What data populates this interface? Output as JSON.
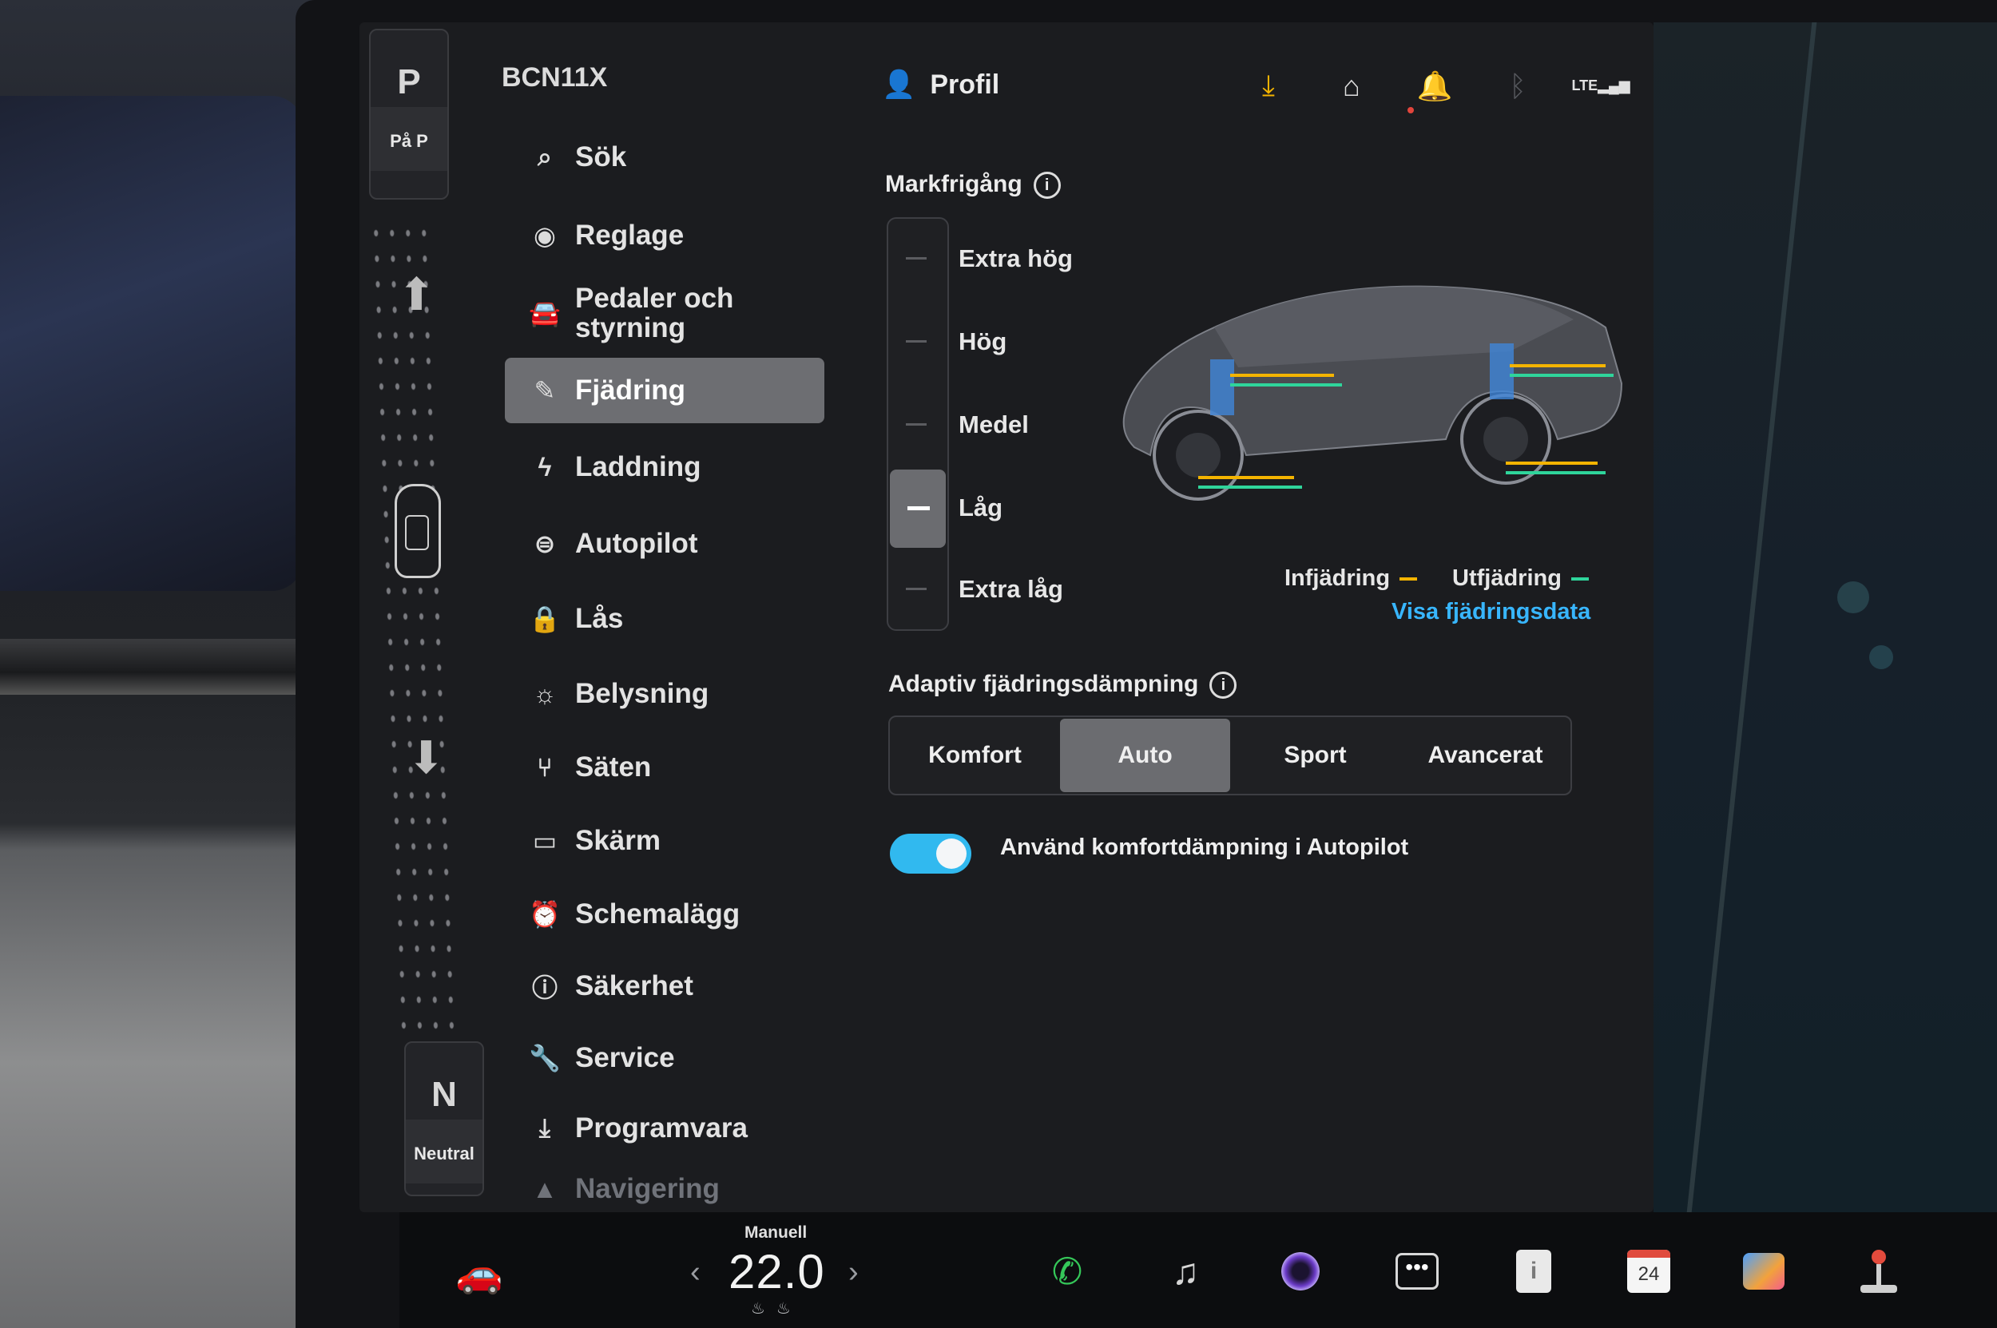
{
  "vehicle": {
    "name": "BCN11X"
  },
  "gear": {
    "top_letter": "P",
    "top_label": "På P",
    "bottom_letter": "N",
    "bottom_label": "Neutral"
  },
  "nav": {
    "items": [
      {
        "label": "Sök",
        "icon": "search-icon"
      },
      {
        "label": "Reglage",
        "icon": "toggle-icon"
      },
      {
        "label": "Pedaler och styrning",
        "icon": "car-icon"
      },
      {
        "label": "Fjädring",
        "icon": "suspension-icon",
        "active": true
      },
      {
        "label": "Laddning",
        "icon": "bolt-icon"
      },
      {
        "label": "Autopilot",
        "icon": "steering-wheel-icon"
      },
      {
        "label": "Lås",
        "icon": "lock-icon"
      },
      {
        "label": "Belysning",
        "icon": "sun-icon"
      },
      {
        "label": "Säten",
        "icon": "seat-icon"
      },
      {
        "label": "Skärm",
        "icon": "display-icon"
      },
      {
        "label": "Schemalägg",
        "icon": "alarm-clock-icon"
      },
      {
        "label": "Säkerhet",
        "icon": "alert-circle-icon"
      },
      {
        "label": "Service",
        "icon": "wrench-icon"
      },
      {
        "label": "Programvara",
        "icon": "download-icon"
      },
      {
        "label": "Navigering",
        "icon": "navigation-arrow-icon"
      }
    ]
  },
  "header": {
    "profile_label": "Profil",
    "status_icons": [
      "download-icon",
      "garage-icon",
      "bell-icon",
      "bluetooth-icon",
      "lte-signal-icon"
    ],
    "lte_label": "LTE",
    "accent_download": "#f4b400"
  },
  "ride_height": {
    "title": "Markfrigång",
    "levels": [
      "Extra hög",
      "Hög",
      "Medel",
      "Låg",
      "Extra låg"
    ],
    "selected": "Låg",
    "legend_compression": "Infjädring",
    "legend_rebound": "Utfjädring",
    "compression_color": "#f4b400",
    "rebound_color": "#2fd59b",
    "link": "Visa fjädringsdata"
  },
  "damping": {
    "title": "Adaptiv fjädringsdämpning",
    "options": [
      "Komfort",
      "Auto",
      "Sport",
      "Avancerat"
    ],
    "selected": "Auto",
    "toggle_label": "Använd komfortdämpning i Autopilot",
    "toggle_on": true,
    "toggle_color": "#31b9ef"
  },
  "dock": {
    "climate_mode": "Manuell",
    "temperature": "22.0",
    "apps": [
      "phone-icon",
      "music-icon",
      "camera-icon",
      "more-icon",
      "notes-icon",
      "calendar-icon",
      "photo-booth-icon",
      "joystick-icon"
    ],
    "calendar_day": "24"
  }
}
